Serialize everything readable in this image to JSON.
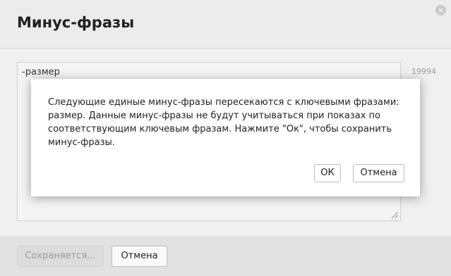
{
  "window": {
    "title": "Минус-фразы",
    "close_icon": "×"
  },
  "editor": {
    "value": "-размер",
    "counter": "19994"
  },
  "footer": {
    "saving_label": "Сохраняется...",
    "cancel_label": "Отмена"
  },
  "dialog": {
    "message": "Следующие единые минус-фразы пересекаются с ключевыми фразами: размер. Данные минус-фразы не будут учитываться при показах по соответствующим ключевым фразам. Нажмите \"Ок\", чтобы сохранить минус-фразы.",
    "ok_label": "ОК",
    "cancel_label": "Отмена"
  }
}
